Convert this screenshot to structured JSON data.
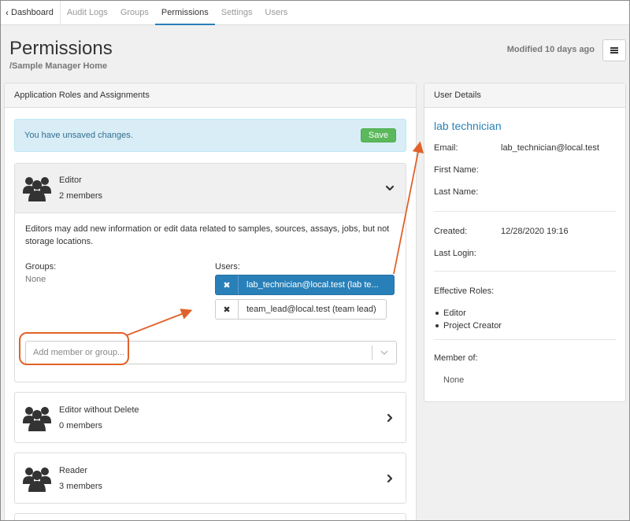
{
  "nav": {
    "back_label": "Dashboard",
    "tabs": [
      {
        "label": "Audit Logs"
      },
      {
        "label": "Groups"
      },
      {
        "label": "Permissions"
      },
      {
        "label": "Settings"
      },
      {
        "label": "Users"
      }
    ],
    "active_tab": "Permissions"
  },
  "header": {
    "title": "Permissions",
    "subtitle": "/Sample Manager Home",
    "modified": "Modified 10 days ago"
  },
  "roles_panel": {
    "title": "Application Roles and Assignments",
    "alert": {
      "message": "You have unsaved changes.",
      "save_label": "Save"
    },
    "roles": [
      {
        "name": "Editor",
        "count": "2 members",
        "description": "Editors may add new information or edit data related to samples, sources, assays, jobs, but not storage locations.",
        "groups_label": "Groups:",
        "groups_value": "None",
        "users_label": "Users:",
        "users": [
          {
            "label": "lab_technician@local.test (lab te..."
          },
          {
            "label": "team_lead@local.test (team lead)"
          }
        ],
        "remove_glyph": "✖",
        "add_placeholder": "Add member or group..."
      },
      {
        "name": "Editor without Delete",
        "count": "0 members"
      },
      {
        "name": "Reader",
        "count": "3 members"
      }
    ]
  },
  "user_details": {
    "title": "User Details",
    "name": "lab technician",
    "email_label": "Email:",
    "email": "lab_technician@local.test",
    "first_name_label": "First Name:",
    "last_name_label": "Last Name:",
    "created_label": "Created:",
    "created": "12/28/2020 19:16",
    "last_login_label": "Last Login:",
    "effective_roles_label": "Effective Roles:",
    "effective_roles": [
      "Editor",
      "Project Creator"
    ],
    "member_of_label": "Member of:",
    "member_of": "None"
  },
  "colors": {
    "accent": "#2980b9",
    "save": "#5cb85c",
    "alert_bg": "#d9edf7",
    "annotation": "#e0622a"
  },
  "icons": {
    "back": "chevron-left-icon",
    "menu": "hamburger-menu-icon",
    "role": "users-group-icon",
    "expanded": "chevron-down-icon",
    "collapsed": "chevron-right-icon",
    "remove": "remove-x-icon",
    "dropdown": "chevron-down-icon"
  }
}
